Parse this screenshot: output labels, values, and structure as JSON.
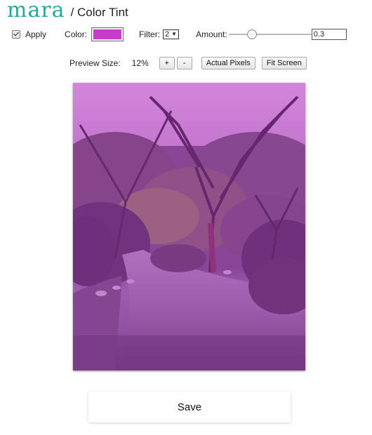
{
  "header": {
    "logo": "mara",
    "title": "/ Color Tint"
  },
  "controls": {
    "apply_label": "Apply",
    "apply_checked": true,
    "color_label": "Color:",
    "color_value": "#c83ccc",
    "filter_label": "Filter:",
    "filter_value": "2",
    "amount_label": "Amount:",
    "amount_value": "0.3"
  },
  "preview_controls": {
    "size_label": "Preview Size:",
    "size_value": "12%",
    "plus_label": "+",
    "minus_label": "-",
    "actual_pixels_label": "Actual Pixels",
    "fit_screen_label": "Fit Screen"
  },
  "preview": {
    "tint_color": "#c83ccc",
    "tint_amount": 0.3
  },
  "footer": {
    "save_label": "Save"
  }
}
